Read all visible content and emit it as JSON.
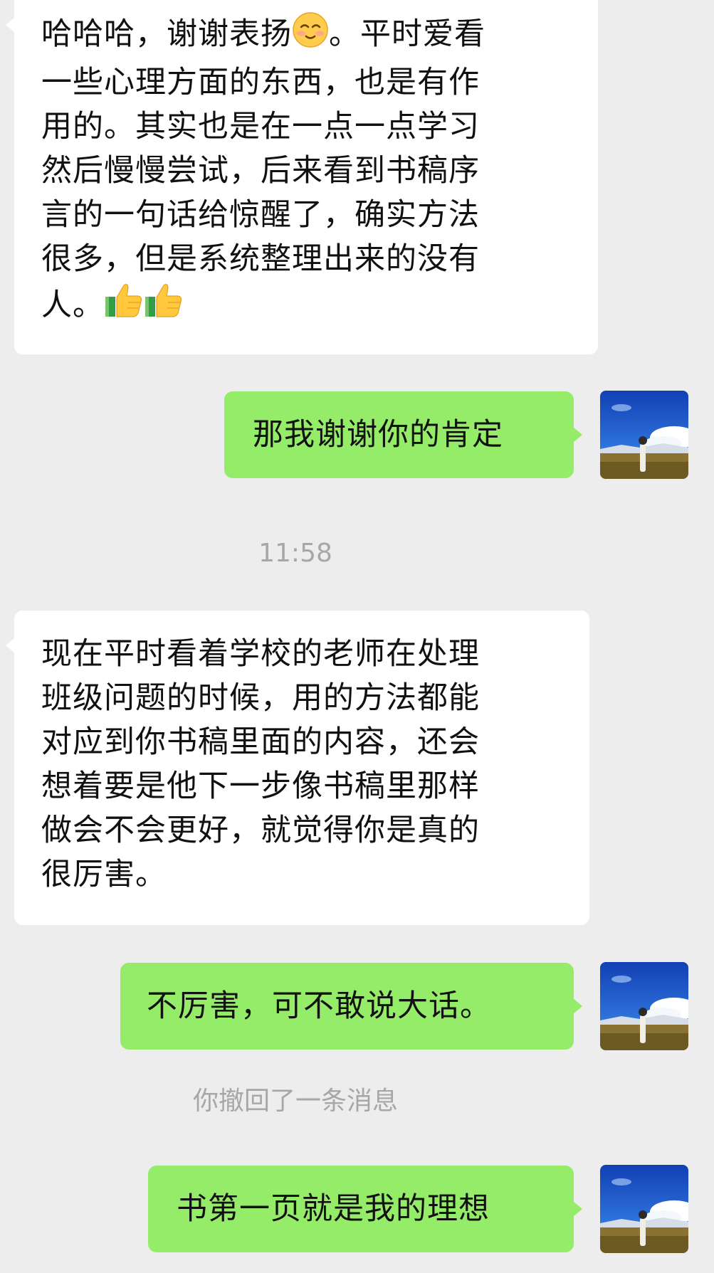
{
  "chat": {
    "msg1": {
      "line1": "哈哈哈，谢谢表扬",
      "line1_tail": "。平时爱看",
      "rest": "一些心理方面的东西，也是有作\n用的。其实也是在一点一点学习\n然后慢慢尝试，后来看到书稿序\n言的一句话给惊醒了，确实方法\n很多，但是系统整理出来的没有",
      "last": "人。",
      "emoji_smile": "smiling-face-emoji",
      "emoji_thumbs": "thumbs-up-emoji"
    },
    "msg2": "那我谢谢你的肯定",
    "timestamp": "11:58",
    "msg3": "现在平时看着学校的老师在处理\n班级问题的时候，用的方法都能\n对应到你书稿里面的内容，还会\n想着要是他下一步像书稿里那样\n做会不会更好，就觉得你是真的\n很厉害。",
    "msg4": "不厉害，可不敢说大话。",
    "recall_notice": "你撤回了一条消息",
    "msg5": "书第一页就是我的理想"
  },
  "colors": {
    "background": "#ededed",
    "incoming_bubble": "#ffffff",
    "outgoing_bubble": "#95ec69",
    "system_text": "#a7a7a7"
  }
}
